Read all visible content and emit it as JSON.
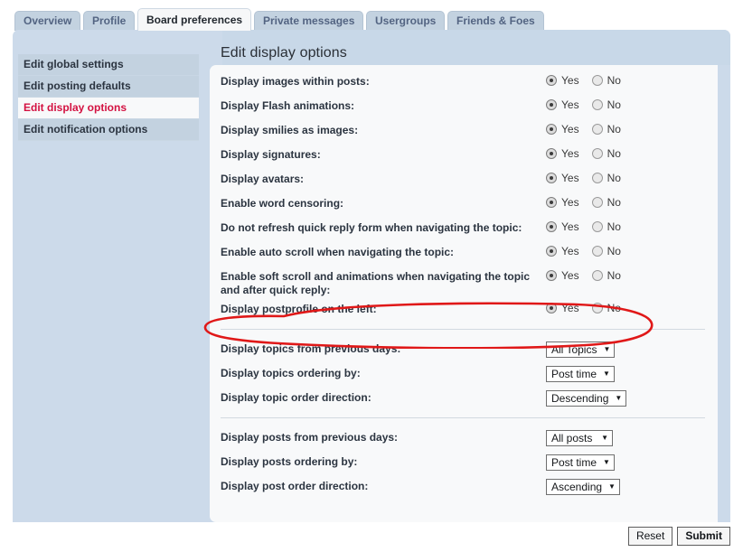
{
  "tabs": [
    {
      "label": "Overview",
      "active": false
    },
    {
      "label": "Profile",
      "active": false
    },
    {
      "label": "Board preferences",
      "active": true
    },
    {
      "label": "Private messages",
      "active": false
    },
    {
      "label": "Usergroups",
      "active": false
    },
    {
      "label": "Friends & Foes",
      "active": false
    }
  ],
  "page": {
    "title": "Edit display options"
  },
  "sidebar": {
    "items": [
      {
        "label": "Edit global settings",
        "active": false
      },
      {
        "label": "Edit posting defaults",
        "active": false
      },
      {
        "label": "Edit display options",
        "active": true
      },
      {
        "label": "Edit notification options",
        "active": false
      }
    ]
  },
  "radio_labels": {
    "yes": "Yes",
    "no": "No"
  },
  "options": [
    {
      "label": "Display images within posts:",
      "value": "Yes"
    },
    {
      "label": "Display Flash animations:",
      "value": "Yes"
    },
    {
      "label": "Display smilies as images:",
      "value": "Yes"
    },
    {
      "label": "Display signatures:",
      "value": "Yes"
    },
    {
      "label": "Display avatars:",
      "value": "Yes"
    },
    {
      "label": "Enable word censoring:",
      "value": "Yes"
    },
    {
      "label": "Do not refresh quick reply form when navigating the topic:",
      "value": "Yes"
    },
    {
      "label": "Enable auto scroll when navigating the topic:",
      "value": "Yes"
    },
    {
      "label": "Enable soft scroll and animations when navigating the topic and after quick reply:",
      "value": "Yes"
    },
    {
      "label": "Display postprofile on the left:",
      "value": "Yes"
    }
  ],
  "topic_options": [
    {
      "label": "Display topics from previous days:",
      "value": "All Topics"
    },
    {
      "label": "Display topics ordering by:",
      "value": "Post time"
    },
    {
      "label": "Display topic order direction:",
      "value": "Descending"
    }
  ],
  "post_options": [
    {
      "label": "Display posts from previous days:",
      "value": "All posts"
    },
    {
      "label": "Display posts ordering by:",
      "value": "Post time"
    },
    {
      "label": "Display post order direction:",
      "value": "Ascending"
    }
  ],
  "buttons": {
    "reset": "Reset",
    "submit": "Submit"
  },
  "annotation": {
    "shape": "hand-drawn-ellipse",
    "color": "#e01818",
    "targets": "Display postprofile on the left:"
  },
  "colors": {
    "page_background": "#ccdaea",
    "content_background": "#f8f9fa",
    "active_sidebar_text": "#d31141",
    "tab_inactive": "#c3d2e0",
    "annotation_red": "#e01818"
  },
  "icons": {
    "caret": "▼"
  }
}
